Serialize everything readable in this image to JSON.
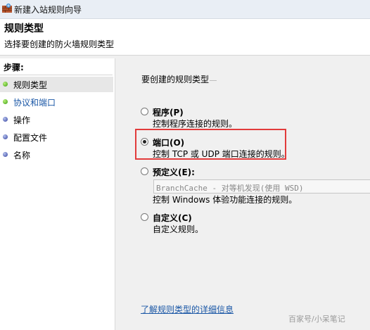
{
  "window": {
    "title": "新建入站规则向导",
    "icon": "firewall-shield-icon"
  },
  "header": {
    "title": "规则类型",
    "subtitle": "选择要创建的防火墙规则类型"
  },
  "steps": {
    "header": "步骤:",
    "items": [
      {
        "label": "规则类型",
        "bullet": "green",
        "current": true
      },
      {
        "label": "协议和端口",
        "bullet": "green",
        "current": false
      },
      {
        "label": "操作",
        "bullet": "blue",
        "current": false
      },
      {
        "label": "配置文件",
        "bullet": "blue",
        "current": false
      },
      {
        "label": "名称",
        "bullet": "blue",
        "current": false
      }
    ]
  },
  "main": {
    "prompt": "要创建的规则类型",
    "options": [
      {
        "label": "程序(P)",
        "desc": "控制程序连接的规则。",
        "selected": false
      },
      {
        "label": "端口(O)",
        "desc": "控制 TCP 或 UDP 端口连接的规则。",
        "selected": true
      },
      {
        "label": "预定义(E):",
        "desc": "控制 Windows 体验功能连接的规则。",
        "selected": false,
        "select_value": "BranchCache - 对等机发现(使用 WSD)"
      },
      {
        "label": "自定义(C)",
        "desc": "自定义规则。",
        "selected": false
      }
    ],
    "learn_more": "了解规则类型的详细信息"
  },
  "watermark": "百家号/小呆笔记",
  "colors": {
    "highlight_border": "#e23b3b",
    "link": "#1a57a6",
    "bullet_green": "#3a9d11",
    "bullet_blue": "#303f9c"
  }
}
